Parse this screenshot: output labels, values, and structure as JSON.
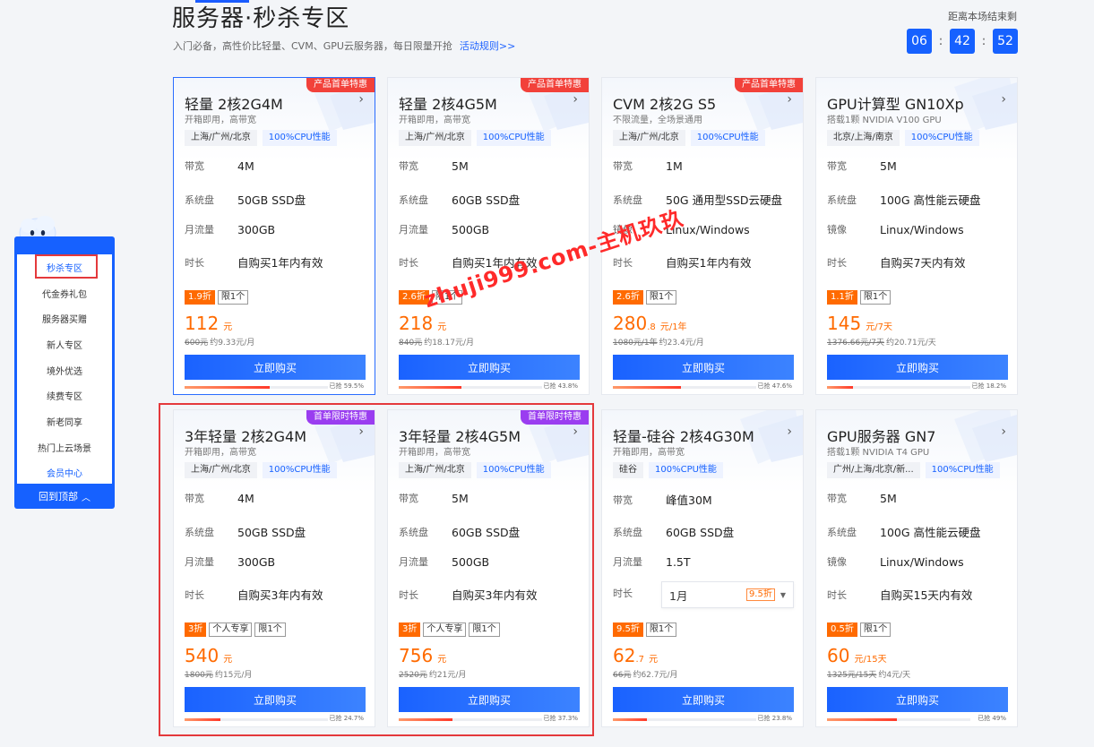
{
  "section": {
    "title": "服务器·秒杀专区",
    "subtitle": "入门必备，高性价比轻量、CVM、GPU云服务器，每日限量开抢",
    "rules_link": "活动规则>>"
  },
  "countdown": {
    "label": "距离本场结束剩",
    "hours": "06",
    "minutes": "42",
    "seconds": "52"
  },
  "sidebar": {
    "items": [
      {
        "label": "秒杀专区"
      },
      {
        "label": "代金券礼包"
      },
      {
        "label": "服务器买赠"
      },
      {
        "label": "新人专区"
      },
      {
        "label": "境外优选"
      },
      {
        "label": "续费专区"
      },
      {
        "label": "新老同享"
      },
      {
        "label": "热门上云场景"
      },
      {
        "label": "会员中心"
      }
    ],
    "back_top": "回到顶部"
  },
  "watermark": "zhuji999.com-主机玖玖",
  "colors": {
    "brand": "#1661ff",
    "price": "#ff6a00",
    "badge_red": "#f2413a",
    "badge_purple": "#9a3df0"
  },
  "cards": [
    {
      "badge": "产品首单特惠",
      "title": "轻量 2核2G4M",
      "desc": "开箱即用，高带宽",
      "region": "上海/广州/北京",
      "cpu": "100%CPU性能",
      "specs": [
        {
          "k": "带宽",
          "v": "4M"
        },
        {
          "k": "系统盘",
          "v": "50GB SSD盘"
        },
        {
          "k": "月流量",
          "v": "300GB"
        },
        {
          "k": "时长",
          "v": "自购买1年内有效"
        }
      ],
      "discount": "1.9折",
      "extra_tag": "",
      "limit": "限1个",
      "price": "112",
      "price_dec": "",
      "price_unit": "元",
      "orig": "600元",
      "per_month": "约9.33元/月",
      "buy": "立即购买",
      "sold_text": "已抢 59.5%",
      "sold": 0.595
    },
    {
      "badge": "产品首单特惠",
      "title": "轻量 2核4G5M",
      "desc": "开箱即用，高带宽",
      "region": "上海/广州/北京",
      "cpu": "100%CPU性能",
      "specs": [
        {
          "k": "带宽",
          "v": "5M"
        },
        {
          "k": "系统盘",
          "v": "60GB SSD盘"
        },
        {
          "k": "月流量",
          "v": "500GB"
        },
        {
          "k": "时长",
          "v": "自购买1年内有效"
        }
      ],
      "discount": "2.6折",
      "extra_tag": "",
      "limit": "限1个",
      "price": "218",
      "price_dec": "",
      "price_unit": "元",
      "orig": "840元",
      "per_month": "约18.17元/月",
      "buy": "立即购买",
      "sold_text": "已抢 43.8%",
      "sold": 0.438
    },
    {
      "badge": "产品首单特惠",
      "title": "CVM 2核2G S5",
      "desc": "不限流量，全场景通用",
      "region": "上海/广州/北京",
      "cpu": "100%CPU性能",
      "specs": [
        {
          "k": "带宽",
          "v": "1M"
        },
        {
          "k": "系统盘",
          "v": "50G 通用型SSD云硬盘"
        },
        {
          "k": "镜像",
          "v": "Linux/Windows"
        },
        {
          "k": "时长",
          "v": "自购买1年内有效"
        }
      ],
      "discount": "2.6折",
      "extra_tag": "",
      "limit": "限1个",
      "price": "280",
      "price_dec": ".8",
      "price_unit": "元/1年",
      "orig": "1080元/1年",
      "per_month": "约23.4元/月",
      "buy": "立即购买",
      "sold_text": "已抢 47.6%",
      "sold": 0.476
    },
    {
      "badge": "",
      "title": "GPU计算型 GN10Xp",
      "desc": "搭载1颗 NVIDIA V100 GPU",
      "region": "北京/上海/南京",
      "cpu": "100%CPU性能",
      "specs": [
        {
          "k": "带宽",
          "v": "5M"
        },
        {
          "k": "系统盘",
          "v": "100G 高性能云硬盘"
        },
        {
          "k": "镜像",
          "v": "Linux/Windows"
        },
        {
          "k": "时长",
          "v": "自购买7天内有效"
        }
      ],
      "discount": "1.1折",
      "extra_tag": "",
      "limit": "限1个",
      "price": "145",
      "price_dec": "",
      "price_unit": "元/7天",
      "orig": "1376.66元/7天",
      "per_month": "约20.71元/天",
      "buy": "立即购买",
      "sold_text": "已抢 18.2%",
      "sold": 0.182
    },
    {
      "badge": "首单限时特惠",
      "title": "3年轻量 2核2G4M",
      "desc": "开箱即用，高带宽",
      "region": "上海/广州/北京",
      "cpu": "100%CPU性能",
      "specs": [
        {
          "k": "带宽",
          "v": "4M"
        },
        {
          "k": "系统盘",
          "v": "50GB SSD盘"
        },
        {
          "k": "月流量",
          "v": "300GB"
        },
        {
          "k": "时长",
          "v": "自购买3年内有效"
        }
      ],
      "discount": "3折",
      "extra_tag": "个人专享",
      "limit": "限1个",
      "price": "540",
      "price_dec": "",
      "price_unit": "元",
      "orig": "1800元",
      "per_month": "约15元/月",
      "buy": "立即购买",
      "sold_text": "已抢 24.7%",
      "sold": 0.247
    },
    {
      "badge": "首单限时特惠",
      "title": "3年轻量 2核4G5M",
      "desc": "开箱即用，高带宽",
      "region": "上海/广州/北京",
      "cpu": "100%CPU性能",
      "specs": [
        {
          "k": "带宽",
          "v": "5M"
        },
        {
          "k": "系统盘",
          "v": "60GB SSD盘"
        },
        {
          "k": "月流量",
          "v": "500GB"
        },
        {
          "k": "时长",
          "v": "自购买3年内有效"
        }
      ],
      "discount": "3折",
      "extra_tag": "个人专享",
      "limit": "限1个",
      "price": "756",
      "price_dec": "",
      "price_unit": "元",
      "orig": "2520元",
      "per_month": "约21元/月",
      "buy": "立即购买",
      "sold_text": "已抢 37.3%",
      "sold": 0.373
    },
    {
      "badge": "",
      "title": "轻量-硅谷 2核4G30M",
      "desc": "开箱即用，高带宽",
      "region": "硅谷",
      "cpu": "100%CPU性能",
      "specs": [
        {
          "k": "带宽",
          "v": "峰值30M"
        },
        {
          "k": "系统盘",
          "v": "60GB SSD盘"
        },
        {
          "k": "月流量",
          "v": "1.5T"
        },
        {
          "k": "时长",
          "v": ""
        }
      ],
      "duration_select": {
        "value": "1月",
        "discount": "9.5折"
      },
      "discount": "9.5折",
      "extra_tag": "",
      "limit": "限1个",
      "price": "62",
      "price_dec": ".7",
      "price_unit": "元",
      "orig": "66元",
      "per_month": "约62.7元/月",
      "buy": "立即购买",
      "sold_text": "已抢 23.8%",
      "sold": 0.238
    },
    {
      "badge": "",
      "title": "GPU服务器 GN7",
      "desc": "搭载1颗 NVIDIA T4 GPU",
      "region": "广州/上海/北京/新...",
      "cpu": "100%CPU性能",
      "specs": [
        {
          "k": "带宽",
          "v": "5M"
        },
        {
          "k": "系统盘",
          "v": "100G 高性能云硬盘"
        },
        {
          "k": "镜像",
          "v": "Linux/Windows"
        },
        {
          "k": "时长",
          "v": "自购买15天内有效"
        }
      ],
      "discount": "0.5折",
      "extra_tag": "",
      "limit": "限1个",
      "price": "60",
      "price_dec": "",
      "price_unit": "元/15天",
      "orig": "1325元/15天",
      "per_month": "约4元/天",
      "buy": "立即购买",
      "sold_text": "已抢 49%",
      "sold": 0.49
    }
  ]
}
